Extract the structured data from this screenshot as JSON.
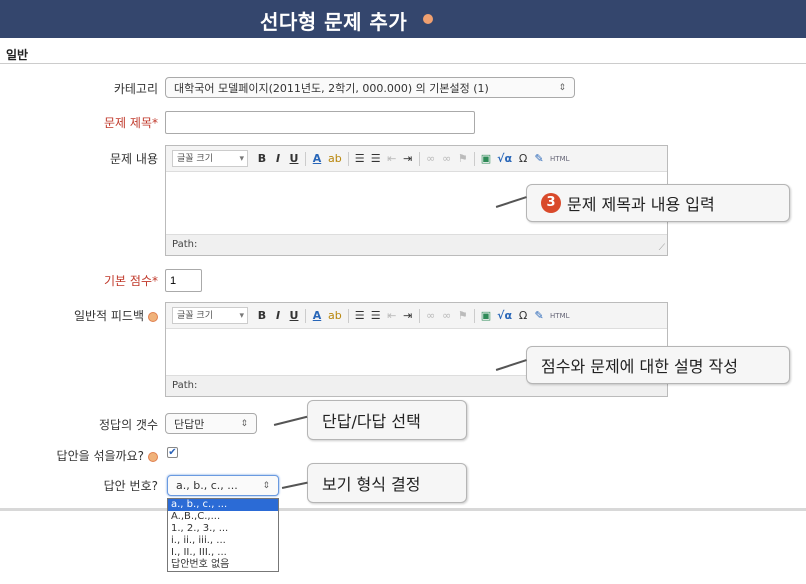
{
  "header": {
    "title": "선다형 문제 추가"
  },
  "section": {
    "general": "일반"
  },
  "fields": {
    "category": {
      "label": "카테고리",
      "value": "대학국어 모델페이지(2011년도, 2학기, 000.000) 의 기본설정 (1)"
    },
    "question_name": {
      "label": "문제 제목",
      "required_mark": "*",
      "value": ""
    },
    "question_text": {
      "label": "문제 내용"
    },
    "default_mark": {
      "label": "기본 점수",
      "required_mark": "*",
      "value": "1"
    },
    "general_feedback": {
      "label": "일반적 피드백"
    },
    "single_answer": {
      "label": "정답의 갯수",
      "value": "단답만"
    },
    "shuffle_answers": {
      "label": "답안을 섞을까요?",
      "checked": true
    },
    "answer_numbering": {
      "label": "답안 번호?",
      "value": "a., b., c., ...",
      "options": [
        "a., b., c., ...",
        "A.,B.,C.,...",
        "1., 2., 3., ...",
        "i., ii., iii., ...",
        "I., II., III., ...",
        "답안번호 없음"
      ]
    }
  },
  "editor": {
    "font_size_label": "글꼴 크기",
    "path_label": "Path:",
    "toolbar": {
      "bold": "B",
      "italic": "I",
      "underline": "U",
      "font_color": "A",
      "highlight": "ab",
      "bullet_list": "☰",
      "numbered_list": "☰",
      "outdent": "⇤",
      "indent": "⇥",
      "link": "∞",
      "unlink": "∞",
      "anchor": "⚑",
      "image": "▣",
      "equation": "√α",
      "special_char": "Ω",
      "edit": "✎",
      "html": "HTML"
    }
  },
  "callouts": {
    "c3": {
      "number": "3",
      "text": "문제 제목과 내용 입력"
    },
    "feedback": {
      "text": "점수와 문제에 대한 설명 작성"
    },
    "single": {
      "text": "단답/다답 선택"
    },
    "numbering": {
      "text": "보기 형식 결정"
    }
  },
  "colors": {
    "header_bg": "#34466d",
    "required": "#c0392b",
    "accent": "#d94a2b",
    "selected_option": "#2b6bd6"
  }
}
